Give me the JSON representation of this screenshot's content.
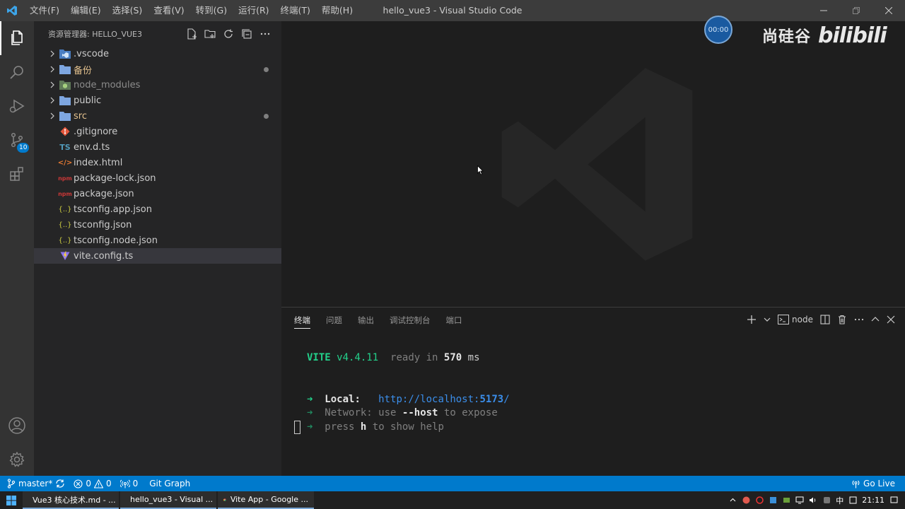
{
  "titlebar": {
    "menu": [
      "文件(F)",
      "编辑(E)",
      "选择(S)",
      "查看(V)",
      "转到(G)",
      "运行(R)",
      "终端(T)",
      "帮助(H)"
    ],
    "title": "hello_vue3 - Visual Studio Code"
  },
  "activitybar": {
    "source_control_badge": "10"
  },
  "sidebar": {
    "title": "资源管理器: HELLO_VUE3",
    "items": [
      {
        "label": ".vscode",
        "type": "folder",
        "icon": "vscode-folder-icon",
        "modified": false
      },
      {
        "label": "备份",
        "type": "folder",
        "icon": "folder-icon",
        "modified": true
      },
      {
        "label": "node_modules",
        "type": "folder",
        "icon": "node-folder-icon",
        "modified": false
      },
      {
        "label": "public",
        "type": "folder",
        "icon": "folder-icon",
        "modified": false
      },
      {
        "label": "src",
        "type": "folder",
        "icon": "folder-icon",
        "modified": true
      },
      {
        "label": ".gitignore",
        "type": "file",
        "icon": "git-icon"
      },
      {
        "label": "env.d.ts",
        "type": "file",
        "icon": "ts-icon",
        "icon_text": "TS"
      },
      {
        "label": "index.html",
        "type": "file",
        "icon": "html-icon",
        "icon_text": "</>"
      },
      {
        "label": "package-lock.json",
        "type": "file",
        "icon": "npm-icon",
        "icon_text": "npm"
      },
      {
        "label": "package.json",
        "type": "file",
        "icon": "npm-icon",
        "icon_text": "npm"
      },
      {
        "label": "tsconfig.app.json",
        "type": "file",
        "icon": "json-icon",
        "icon_text": "{..}"
      },
      {
        "label": "tsconfig.json",
        "type": "file",
        "icon": "json-icon",
        "icon_text": "{..}"
      },
      {
        "label": "tsconfig.node.json",
        "type": "file",
        "icon": "json-icon",
        "icon_text": "{..}"
      },
      {
        "label": "vite.config.ts",
        "type": "file",
        "icon": "vite-icon",
        "selected": true
      }
    ]
  },
  "overlay": {
    "timer": "00:00",
    "watermark_cn": "尚硅谷",
    "watermark_bili": "bilibili"
  },
  "panel": {
    "tabs": [
      "终端",
      "问题",
      "输出",
      "调试控制台",
      "端口"
    ],
    "active_tab": "终端",
    "terminal_name": "node",
    "terminal": {
      "vite": "VITE",
      "version": "v4.4.11",
      "ready": "ready in",
      "ms_value": "570",
      "ms": "ms",
      "arrow": "➜",
      "local_label": "Local:",
      "local_url_prefix": "http://localhost:",
      "local_port": "5173",
      "local_url_suffix": "/",
      "network_label": "Network:",
      "network_text_1": "use",
      "network_flag": "--host",
      "network_text_2": "to expose",
      "press": "press",
      "press_key": "h",
      "press_text": "to show help"
    }
  },
  "statusbar": {
    "branch": "master*",
    "errors": "0",
    "warnings": "0",
    "ports": "0",
    "git_graph": "Git Graph",
    "go_live": "Go Live"
  },
  "taskbar": {
    "tasks": [
      "Vue3 核心技术.md - ...",
      "hello_vue3 - Visual ...",
      "Vite App - Google ..."
    ],
    "ime": "中",
    "clock": "21:11"
  },
  "colors": {
    "accent": "#007acc",
    "terminal_green": "#23d18b",
    "terminal_link": "#3b8eea"
  }
}
